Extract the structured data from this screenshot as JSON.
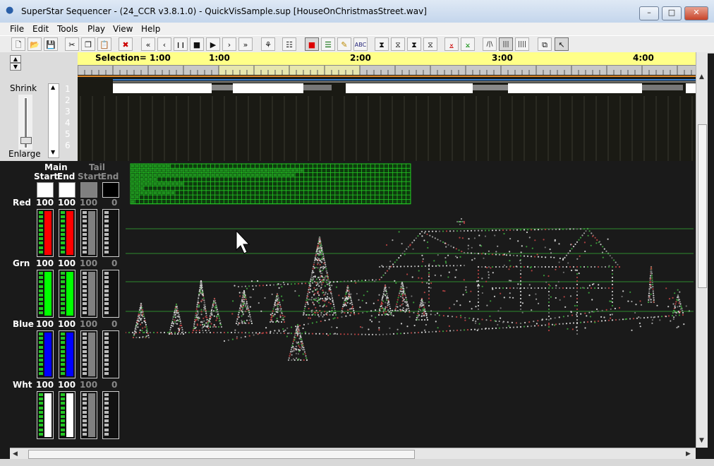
{
  "window": {
    "title": "SuperStar Sequencer - (24_CCR v3.8.1.0) - QuickVisSample.sup [HouseOnChristmasStreet.wav]",
    "minimize": "–",
    "maximize": "□",
    "close": "✕"
  },
  "menu": [
    "File",
    "Edit",
    "Tools",
    "Play",
    "View",
    "Help"
  ],
  "toolbar": [
    {
      "name": "new-icon",
      "glyph": "🗋"
    },
    {
      "name": "open-icon",
      "glyph": "📂"
    },
    {
      "name": "save-icon",
      "glyph": "💾"
    },
    {
      "name": "cut-icon",
      "glyph": "✂"
    },
    {
      "name": "copy-icon",
      "glyph": "❐"
    },
    {
      "name": "paste-icon",
      "glyph": "📋"
    },
    {
      "name": "delete-icon",
      "glyph": "✖"
    },
    {
      "name": "rewind-icon",
      "glyph": "«"
    },
    {
      "name": "step-back-icon",
      "glyph": "‹"
    },
    {
      "name": "pause-icon",
      "glyph": "❙❙"
    },
    {
      "name": "stop-icon",
      "glyph": "■"
    },
    {
      "name": "play-icon",
      "glyph": "▶"
    },
    {
      "name": "step-forward-icon",
      "glyph": "›"
    },
    {
      "name": "fast-forward-icon",
      "glyph": "»"
    },
    {
      "name": "camera-icon",
      "glyph": "⚘"
    },
    {
      "name": "clapper-icon",
      "glyph": "☷"
    },
    {
      "name": "color-select-icon",
      "glyph": "■"
    },
    {
      "name": "palette-icon",
      "glyph": "☰"
    },
    {
      "name": "pencil-icon",
      "glyph": "✎"
    },
    {
      "name": "text-effect-icon",
      "glyph": "ABC"
    },
    {
      "name": "morph-icon-1",
      "glyph": "⧗"
    },
    {
      "name": "morph-icon-2",
      "glyph": "⧖"
    },
    {
      "name": "morph-icon-3",
      "glyph": "⧗"
    },
    {
      "name": "morph-icon-4",
      "glyph": "⧖"
    },
    {
      "name": "ramp-up-icon",
      "glyph": "⨱"
    },
    {
      "name": "ramp-down-icon",
      "glyph": "⨲"
    },
    {
      "name": "spin-icon",
      "glyph": "/|\\"
    },
    {
      "name": "grid-3-icon",
      "glyph": "|||"
    },
    {
      "name": "grid-4-icon",
      "glyph": "||||"
    },
    {
      "name": "window-icon",
      "glyph": "⧉"
    },
    {
      "name": "pointer-icon",
      "glyph": "↖"
    }
  ],
  "zoom": {
    "shrink": "Shrink",
    "enlarge": "Enlarge"
  },
  "channels": [
    "1",
    "2",
    "3",
    "4",
    "5",
    "6"
  ],
  "timeline": {
    "selection": "Selection= 1:00",
    "marks": [
      "1:00",
      "2:00",
      "3:00",
      "4:00"
    ]
  },
  "intensity": {
    "main": "Main",
    "tail": "Tail",
    "start": "Start",
    "end": "End",
    "rows": [
      {
        "label": "Red",
        "main_start": "100",
        "main_end": "100",
        "tail_start": "100",
        "tail_end": "0",
        "color": "#ff0000"
      },
      {
        "label": "Grn",
        "main_start": "100",
        "main_end": "100",
        "tail_start": "100",
        "tail_end": "0",
        "color": "#00ff00"
      },
      {
        "label": "Blue",
        "main_start": "100",
        "main_end": "100",
        "tail_start": "100",
        "tail_end": "0",
        "color": "#0000ff"
      },
      {
        "label": "Wht",
        "main_start": "100",
        "main_end": "100",
        "tail_start": "100",
        "tail_end": "0",
        "color": "#ffffff"
      }
    ]
  },
  "colors": {
    "guide": "#2e8b2e",
    "grid": "#22c822"
  }
}
